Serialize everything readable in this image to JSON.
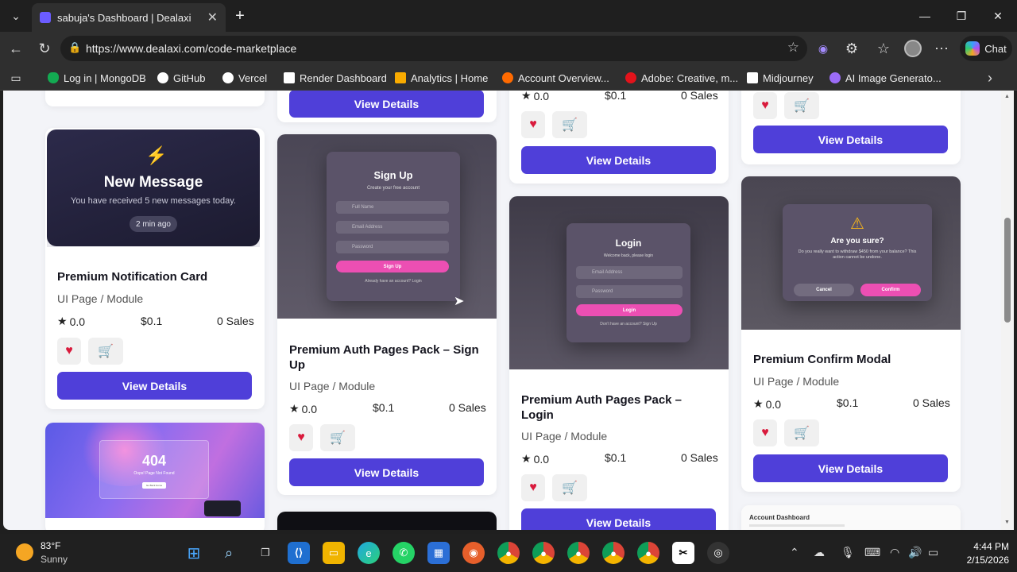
{
  "browser": {
    "tab_title": "sabuja's Dashboard | Dealaxi",
    "url": "https://www.dealaxi.com/code-marketplace",
    "chat_label": "Chat"
  },
  "bookmarks": [
    {
      "label": "Log in | MongoDB",
      "color": "#13aa52"
    },
    {
      "label": "GitHub",
      "color": "#ffffff"
    },
    {
      "label": "Vercel",
      "color": "#ffffff"
    },
    {
      "label": "Render Dashboard",
      "color": "#ffffff"
    },
    {
      "label": "Analytics | Home",
      "color": "#f9ab00"
    },
    {
      "label": "Account Overview...",
      "color": "#ff6a00"
    },
    {
      "label": "Adobe: Creative, m...",
      "color": "#e3131b"
    },
    {
      "label": "Midjourney",
      "color": "#ffffff"
    },
    {
      "label": "AI Image Generato...",
      "color": "#9b6cf6"
    }
  ],
  "common": {
    "view_details": "View Details",
    "category": "UI Page / Module",
    "rating": "0.0",
    "price": "$0.1",
    "sales": "0 Sales",
    "star": "★",
    "heart": "♥",
    "cart": "🛒"
  },
  "products": {
    "notification": {
      "title": "Premium Notification Card",
      "preview_heading": "New Message",
      "preview_text": "You have received 5 new messages today.",
      "preview_badge": "2 min ago"
    },
    "signup": {
      "title": "Premium Auth Pages Pack – Sign Up",
      "preview_heading": "Sign Up",
      "preview_sub": "Create your free account",
      "fields": [
        "Full Name",
        "Email Address",
        "Password"
      ],
      "preview_button": "Sign Up",
      "preview_footer": "Already have an account? Login"
    },
    "login": {
      "title": "Premium Auth Pages Pack – Login",
      "preview_heading": "Login",
      "preview_sub": "Welcome back, please login",
      "fields": [
        "Email Address",
        "Password"
      ],
      "preview_button": "Login",
      "preview_footer": "Don't have an account? Sign Up"
    },
    "confirm": {
      "title": "Premium Confirm Modal",
      "preview_heading": "Are you sure?",
      "preview_text": "Do you really want to withdraw $450 from your balance? This action cannot be undone.",
      "cancel": "Cancel",
      "confirm": "Confirm"
    },
    "notfound": {
      "preview_heading": "404",
      "preview_sub": "Oops! Page Not Found",
      "preview_button": "Go Back Home"
    },
    "dashboard": {
      "preview_heading": "Account Dashboard"
    }
  },
  "taskbar": {
    "temperature": "83°F",
    "weather": "Sunny",
    "time": "4:44 PM",
    "date": "2/15/2026"
  }
}
